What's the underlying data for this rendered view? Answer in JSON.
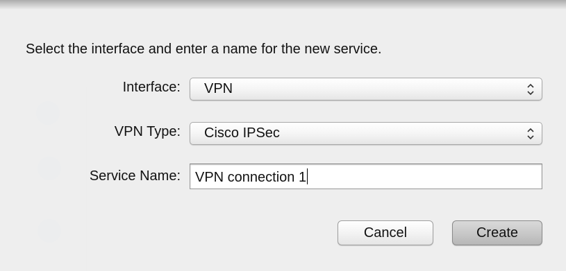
{
  "sheet": {
    "instruction": "Select the interface and enter a name for the new service.",
    "fields": {
      "interface": {
        "label": "Interface:",
        "value": "VPN"
      },
      "vpn_type": {
        "label": "VPN Type:",
        "value": "Cisco IPSec"
      },
      "service_name": {
        "label": "Service Name:",
        "value": "VPN connection 1"
      }
    },
    "buttons": {
      "cancel": "Cancel",
      "create": "Create"
    }
  },
  "background": {
    "sidebar_icons": [
      "wifi-icon",
      "network-icon",
      "bluetooth-icon"
    ]
  },
  "icons": {
    "popup_arrows": "up-down-chevron-icon"
  }
}
